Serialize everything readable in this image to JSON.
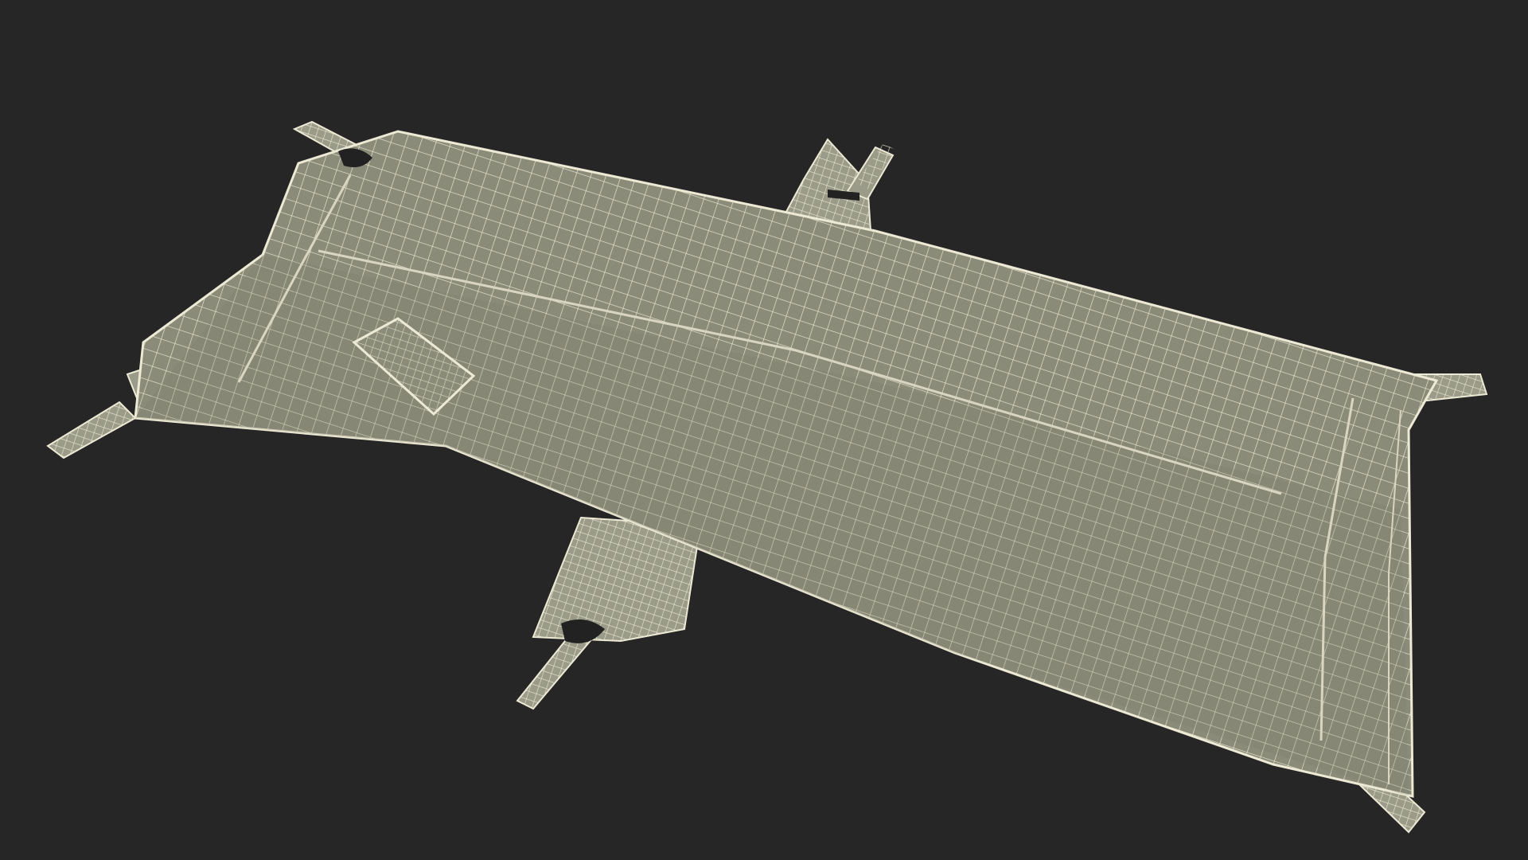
{
  "scene": {
    "subject": "stretcher-wireframe-model",
    "colors": {
      "background": "#262626",
      "fabric": "#8a8b79",
      "fabric_shade": "#7a7b6a",
      "wire": "#ece9d4",
      "seam": "#d8d6c2",
      "hole": "#222222",
      "strap": "#9a9b88"
    }
  }
}
